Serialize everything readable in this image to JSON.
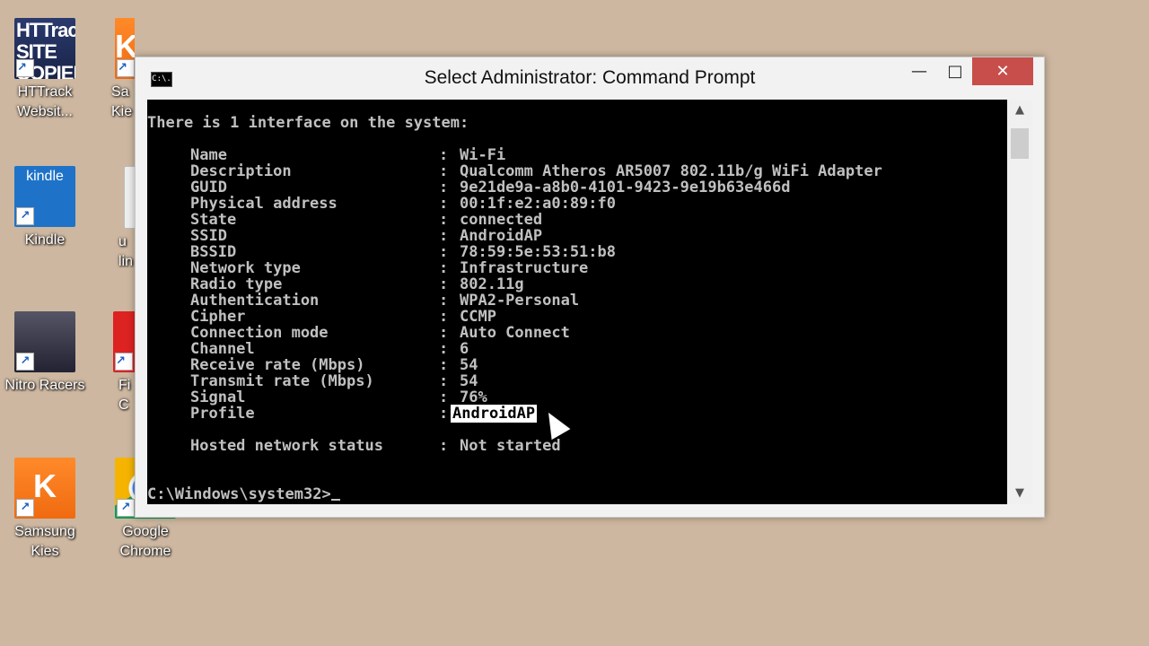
{
  "desktop": {
    "icons": [
      {
        "label": "HTTrack Websit...",
        "art": "HTTrack SITE COPIER"
      },
      {
        "label": "Sa\nKie",
        "art": "K"
      },
      {
        "label": "Kindle",
        "art": "kindle"
      },
      {
        "label": "u\nlin",
        "art": ""
      },
      {
        "label": "Nitro Racers",
        "art": ""
      },
      {
        "label": "Fi\nC",
        "art": ""
      },
      {
        "label": "Samsung Kies",
        "art": "K"
      },
      {
        "label": "Google Chrome",
        "art": ""
      }
    ]
  },
  "window": {
    "title": "Select Administrator: Command Prompt",
    "icon_text": "C:\\.",
    "min_glyph": "—",
    "max_glyph": "□",
    "close_glyph": "✕"
  },
  "console": {
    "intro": "There is 1 interface on the system:",
    "fields": [
      {
        "key": "Name",
        "value": "Wi-Fi"
      },
      {
        "key": "Description",
        "value": "Qualcomm Atheros AR5007 802.11b/g WiFi Adapter"
      },
      {
        "key": "GUID",
        "value": "9e21de9a-a8b0-4101-9423-9e19b63e466d"
      },
      {
        "key": "Physical address",
        "value": "00:1f:e2:a0:89:f0"
      },
      {
        "key": "State",
        "value": "connected"
      },
      {
        "key": "SSID",
        "value": "AndroidAP"
      },
      {
        "key": "BSSID",
        "value": "78:59:5e:53:51:b8"
      },
      {
        "key": "Network type",
        "value": "Infrastructure"
      },
      {
        "key": "Radio type",
        "value": "802.11g"
      },
      {
        "key": "Authentication",
        "value": "WPA2-Personal"
      },
      {
        "key": "Cipher",
        "value": "CCMP"
      },
      {
        "key": "Connection mode",
        "value": "Auto Connect"
      },
      {
        "key": "Channel",
        "value": "6"
      },
      {
        "key": "Receive rate (Mbps)",
        "value": "54"
      },
      {
        "key": "Transmit rate (Mbps)",
        "value": "54"
      },
      {
        "key": "Signal",
        "value": "76%"
      },
      {
        "key": "Profile",
        "value": "AndroidAP"
      }
    ],
    "separator": ":",
    "hosted_key": "Hosted network status",
    "hosted_value": "Not started",
    "prompt": "C:\\Windows\\system32>"
  },
  "scrollbar": {
    "up_glyph": "▲",
    "down_glyph": "▼"
  }
}
